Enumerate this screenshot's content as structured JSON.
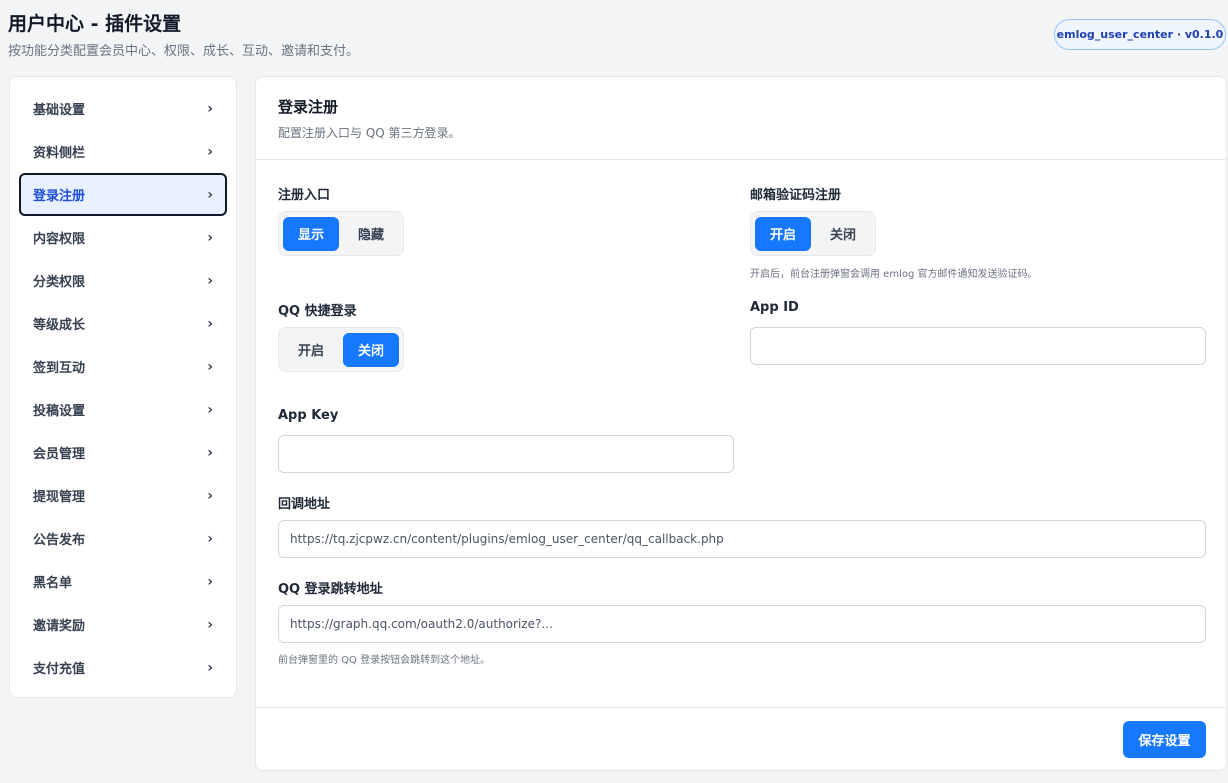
{
  "header": {
    "title": "用户中心 - 插件设置",
    "subtitle": "按功能分类配置会员中心、权限、成长、互动、邀请和支付。",
    "version_badge": "emlog_user_center · v0.1.0"
  },
  "sidebar": {
    "items": [
      {
        "label": "基础设置",
        "active": false
      },
      {
        "label": "资料侧栏",
        "active": false
      },
      {
        "label": "登录注册",
        "active": true
      },
      {
        "label": "内容权限",
        "active": false
      },
      {
        "label": "分类权限",
        "active": false
      },
      {
        "label": "等级成长",
        "active": false
      },
      {
        "label": "签到互动",
        "active": false
      },
      {
        "label": "投稿设置",
        "active": false
      },
      {
        "label": "会员管理",
        "active": false
      },
      {
        "label": "提现管理",
        "active": false
      },
      {
        "label": "公告发布",
        "active": false
      },
      {
        "label": "黑名单",
        "active": false
      },
      {
        "label": "邀请奖励",
        "active": false
      },
      {
        "label": "支付充值",
        "active": false
      }
    ],
    "chevron": "›"
  },
  "panel": {
    "title": "登录注册",
    "description": "配置注册入口与 QQ 第三方登录。",
    "register_entry": {
      "label": "注册入口",
      "options": [
        "显示",
        "隐藏"
      ],
      "selected": "显示"
    },
    "email_code": {
      "label": "邮箱验证码注册",
      "options": [
        "开启",
        "关闭"
      ],
      "selected": "开启",
      "help": "开启后，前台注册弹窗会调用 emlog 官方邮件通知发送验证码。"
    },
    "qq_login": {
      "label": "QQ 快捷登录",
      "options": [
        "开启",
        "关闭"
      ],
      "selected": "关闭"
    },
    "app_id": {
      "label": "App ID",
      "value": ""
    },
    "app_key": {
      "label": "App Key",
      "value": ""
    },
    "callback": {
      "label": "回调地址",
      "value": "https://tq.zjcpwz.cn/content/plugins/emlog_user_center/qq_callback.php"
    },
    "qq_redirect": {
      "label": "QQ 登录跳转地址",
      "value": "https://graph.qq.com/oauth2.0/authorize?...",
      "help": "前台弹窗里的 QQ 登录按钮会跳转到这个地址。"
    },
    "save_label": "保存设置"
  },
  "colors": {
    "accent": "#1677ff",
    "active_nav_bg": "#e8f1ff"
  }
}
